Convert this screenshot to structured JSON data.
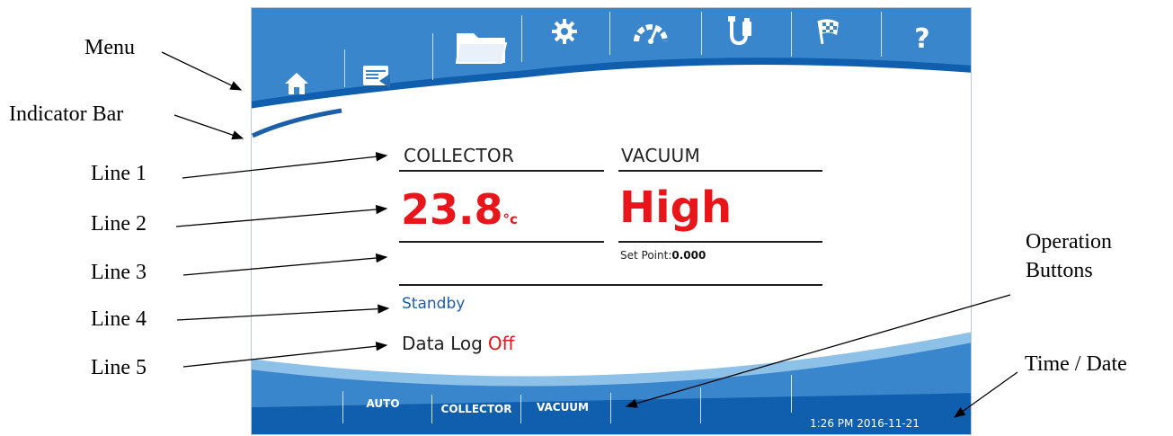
{
  "callouts": {
    "menu": "Menu",
    "indicator_bar": "Indicator Bar",
    "line1": "Line 1",
    "line2": "Line 2",
    "line3": "Line 3",
    "line4": "Line 4",
    "line5": "Line 5",
    "operation_buttons_l1": "Operation",
    "operation_buttons_l2": "Buttons",
    "time_date": "Time / Date"
  },
  "menu": {
    "items": [
      {
        "icon": "home-icon"
      },
      {
        "icon": "display-icon"
      },
      {
        "icon": "folder-icon"
      },
      {
        "icon": "gear-icon"
      },
      {
        "icon": "gauge-icon"
      },
      {
        "icon": "usb-icon"
      },
      {
        "icon": "flag-icon"
      },
      {
        "icon": "help-icon",
        "glyph": "?"
      }
    ]
  },
  "collector": {
    "label": "COLLECTOR",
    "value": "23.8",
    "unit": "°c"
  },
  "vacuum": {
    "label": "VACUUM",
    "value": "High",
    "setpoint_label": "Set Point:",
    "setpoint_value": "0.000"
  },
  "status": "Standby",
  "datalog": {
    "label": "Data Log",
    "state": "Off"
  },
  "operation_buttons": [
    {
      "label": "AUTO"
    },
    {
      "label": "COLLECTOR"
    },
    {
      "label": "VACUUM"
    },
    {
      "label": ""
    },
    {
      "label": ""
    }
  ],
  "clock": {
    "time": "1:26 PM",
    "date": "2016-11-21"
  },
  "colors": {
    "panel_blue": "#2f7ac2",
    "panel_dark": "#0f5fae",
    "accent_red": "#e8151b",
    "status_blue": "#1e5ca8"
  }
}
